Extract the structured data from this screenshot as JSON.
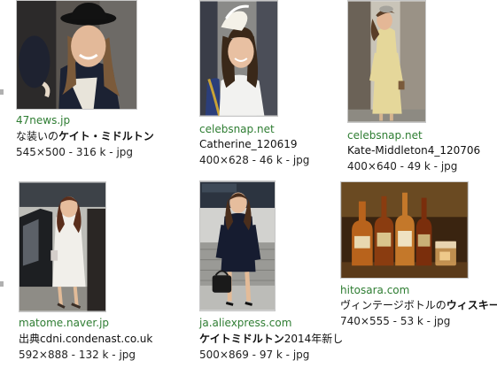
{
  "results": [
    {
      "domain": "47news.jp",
      "title_prefix": "な装いの",
      "title_bold": "ケイト・ミドルトン",
      "title_suffix": "",
      "meta": "545×500 - 316 k - jpg",
      "image": "woman-in-black-hat"
    },
    {
      "domain": "celebsnap.net",
      "title_prefix": "Catherine_120619",
      "title_bold": "",
      "title_suffix": "",
      "meta": "400×628 - 46 k - jpg",
      "image": "woman-in-white-fascinator"
    },
    {
      "domain": "celebsnap.net",
      "title_prefix": "Kate-Middleton4_120706",
      "title_bold": "",
      "title_suffix": "",
      "meta": "400×640 - 49 k - jpg",
      "image": "woman-in-yellow-coat"
    },
    {
      "domain": "matome.naver.jp",
      "title_prefix": "出典cdni.condenast.co.uk",
      "title_bold": "",
      "title_suffix": "",
      "meta": "592×888 - 132 k - jpg",
      "image": "woman-in-white-coat-by-car"
    },
    {
      "domain": "ja.aliexpress.com",
      "title_prefix": "",
      "title_bold": "ケイトミドルトン",
      "title_suffix": "2014年新し",
      "meta": "500×869 - 97 k - jpg",
      "image": "woman-in-navy-suit"
    },
    {
      "domain": "hitosara.com",
      "title_prefix": "ヴィンテージボトルの",
      "title_bold": "ウィスキー",
      "title_suffix": "",
      "meta": "740×555 - 53 k - jpg",
      "image": "whisky-bottles"
    }
  ],
  "colors": {
    "domain_text": "#2e7d32",
    "body_text": "#111111",
    "thumb_border": "#c8c8c8"
  }
}
